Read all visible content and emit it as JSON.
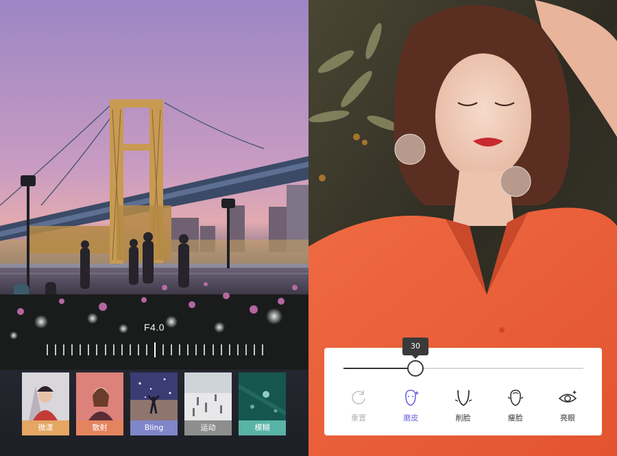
{
  "left_panel": {
    "aperture": {
      "value_label": "F4.0",
      "tick_count": 27,
      "selected_tick": 13
    },
    "filters": [
      {
        "label": "微漾",
        "color": "#e4a662"
      },
      {
        "label": "散射",
        "color": "#e4845f"
      },
      {
        "label": "Bling",
        "color": "#7f86c9"
      },
      {
        "label": "运动",
        "color": "#8e8e8e"
      },
      {
        "label": "模糊",
        "color": "#59b3a7"
      }
    ]
  },
  "right_panel": {
    "beauty_slider": {
      "value": 30,
      "value_label": "30",
      "max": 100
    },
    "tools": [
      {
        "label": "重置",
        "icon": "reset-icon",
        "state": "disabled"
      },
      {
        "label": "磨皮",
        "icon": "smooth-skin-icon",
        "state": "active"
      },
      {
        "label": "削脸",
        "icon": "slim-jaw-icon",
        "state": "normal"
      },
      {
        "label": "瘦脸",
        "icon": "thin-face-icon",
        "state": "normal"
      },
      {
        "label": "亮眼",
        "icon": "bright-eye-icon",
        "state": "normal"
      }
    ],
    "accent_color": "#6b63e0"
  }
}
